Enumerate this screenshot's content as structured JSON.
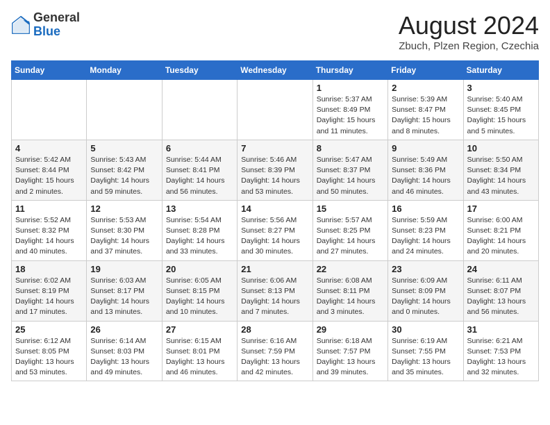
{
  "header": {
    "logo_general": "General",
    "logo_blue": "Blue",
    "month_title": "August 2024",
    "location": "Zbuch, Plzen Region, Czechia"
  },
  "weekdays": [
    "Sunday",
    "Monday",
    "Tuesday",
    "Wednesday",
    "Thursday",
    "Friday",
    "Saturday"
  ],
  "weeks": [
    [
      {
        "day": "",
        "info": ""
      },
      {
        "day": "",
        "info": ""
      },
      {
        "day": "",
        "info": ""
      },
      {
        "day": "",
        "info": ""
      },
      {
        "day": "1",
        "info": "Sunrise: 5:37 AM\nSunset: 8:49 PM\nDaylight: 15 hours\nand 11 minutes."
      },
      {
        "day": "2",
        "info": "Sunrise: 5:39 AM\nSunset: 8:47 PM\nDaylight: 15 hours\nand 8 minutes."
      },
      {
        "day": "3",
        "info": "Sunrise: 5:40 AM\nSunset: 8:45 PM\nDaylight: 15 hours\nand 5 minutes."
      }
    ],
    [
      {
        "day": "4",
        "info": "Sunrise: 5:42 AM\nSunset: 8:44 PM\nDaylight: 15 hours\nand 2 minutes."
      },
      {
        "day": "5",
        "info": "Sunrise: 5:43 AM\nSunset: 8:42 PM\nDaylight: 14 hours\nand 59 minutes."
      },
      {
        "day": "6",
        "info": "Sunrise: 5:44 AM\nSunset: 8:41 PM\nDaylight: 14 hours\nand 56 minutes."
      },
      {
        "day": "7",
        "info": "Sunrise: 5:46 AM\nSunset: 8:39 PM\nDaylight: 14 hours\nand 53 minutes."
      },
      {
        "day": "8",
        "info": "Sunrise: 5:47 AM\nSunset: 8:37 PM\nDaylight: 14 hours\nand 50 minutes."
      },
      {
        "day": "9",
        "info": "Sunrise: 5:49 AM\nSunset: 8:36 PM\nDaylight: 14 hours\nand 46 minutes."
      },
      {
        "day": "10",
        "info": "Sunrise: 5:50 AM\nSunset: 8:34 PM\nDaylight: 14 hours\nand 43 minutes."
      }
    ],
    [
      {
        "day": "11",
        "info": "Sunrise: 5:52 AM\nSunset: 8:32 PM\nDaylight: 14 hours\nand 40 minutes."
      },
      {
        "day": "12",
        "info": "Sunrise: 5:53 AM\nSunset: 8:30 PM\nDaylight: 14 hours\nand 37 minutes."
      },
      {
        "day": "13",
        "info": "Sunrise: 5:54 AM\nSunset: 8:28 PM\nDaylight: 14 hours\nand 33 minutes."
      },
      {
        "day": "14",
        "info": "Sunrise: 5:56 AM\nSunset: 8:27 PM\nDaylight: 14 hours\nand 30 minutes."
      },
      {
        "day": "15",
        "info": "Sunrise: 5:57 AM\nSunset: 8:25 PM\nDaylight: 14 hours\nand 27 minutes."
      },
      {
        "day": "16",
        "info": "Sunrise: 5:59 AM\nSunset: 8:23 PM\nDaylight: 14 hours\nand 24 minutes."
      },
      {
        "day": "17",
        "info": "Sunrise: 6:00 AM\nSunset: 8:21 PM\nDaylight: 14 hours\nand 20 minutes."
      }
    ],
    [
      {
        "day": "18",
        "info": "Sunrise: 6:02 AM\nSunset: 8:19 PM\nDaylight: 14 hours\nand 17 minutes."
      },
      {
        "day": "19",
        "info": "Sunrise: 6:03 AM\nSunset: 8:17 PM\nDaylight: 14 hours\nand 13 minutes."
      },
      {
        "day": "20",
        "info": "Sunrise: 6:05 AM\nSunset: 8:15 PM\nDaylight: 14 hours\nand 10 minutes."
      },
      {
        "day": "21",
        "info": "Sunrise: 6:06 AM\nSunset: 8:13 PM\nDaylight: 14 hours\nand 7 minutes."
      },
      {
        "day": "22",
        "info": "Sunrise: 6:08 AM\nSunset: 8:11 PM\nDaylight: 14 hours\nand 3 minutes."
      },
      {
        "day": "23",
        "info": "Sunrise: 6:09 AM\nSunset: 8:09 PM\nDaylight: 14 hours\nand 0 minutes."
      },
      {
        "day": "24",
        "info": "Sunrise: 6:11 AM\nSunset: 8:07 PM\nDaylight: 13 hours\nand 56 minutes."
      }
    ],
    [
      {
        "day": "25",
        "info": "Sunrise: 6:12 AM\nSunset: 8:05 PM\nDaylight: 13 hours\nand 53 minutes."
      },
      {
        "day": "26",
        "info": "Sunrise: 6:14 AM\nSunset: 8:03 PM\nDaylight: 13 hours\nand 49 minutes."
      },
      {
        "day": "27",
        "info": "Sunrise: 6:15 AM\nSunset: 8:01 PM\nDaylight: 13 hours\nand 46 minutes."
      },
      {
        "day": "28",
        "info": "Sunrise: 6:16 AM\nSunset: 7:59 PM\nDaylight: 13 hours\nand 42 minutes."
      },
      {
        "day": "29",
        "info": "Sunrise: 6:18 AM\nSunset: 7:57 PM\nDaylight: 13 hours\nand 39 minutes."
      },
      {
        "day": "30",
        "info": "Sunrise: 6:19 AM\nSunset: 7:55 PM\nDaylight: 13 hours\nand 35 minutes."
      },
      {
        "day": "31",
        "info": "Sunrise: 6:21 AM\nSunset: 7:53 PM\nDaylight: 13 hours\nand 32 minutes."
      }
    ]
  ]
}
